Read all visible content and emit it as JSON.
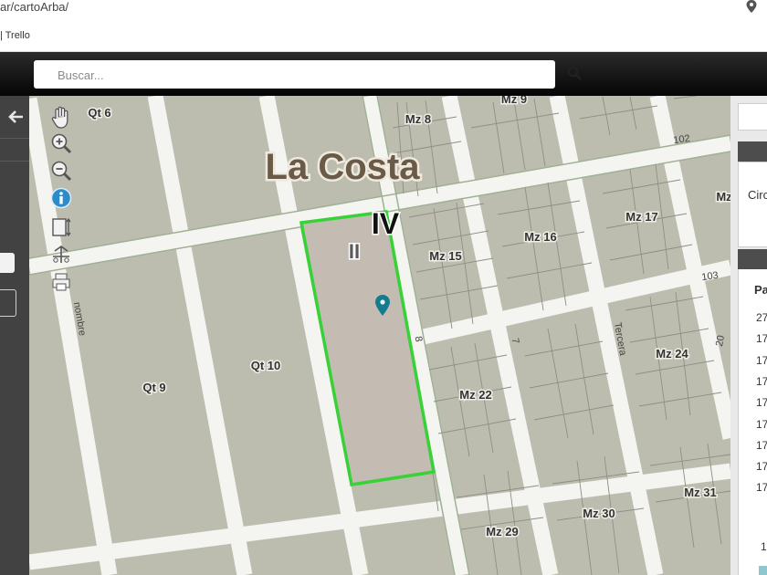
{
  "browser": {
    "url_fragment": "ar/cartoArba/",
    "bookmark": "| Trello"
  },
  "search": {
    "placeholder": "Buscar..."
  },
  "map": {
    "town_name": "La Costa",
    "parcel_labels": [
      "IV",
      "II"
    ],
    "block_labels": [
      "Qt 6",
      "Mz 8",
      "Mz 9",
      "Mz 17",
      "Mz 16",
      "Mz 15",
      "Mz",
      "Mz 24",
      "Mz 22",
      "Qt 10",
      "Qt 9",
      "Mz 31",
      "Mz 30",
      "Mz 29"
    ],
    "street_labels": [
      "102",
      "103",
      "20",
      "7",
      "8",
      "Tercera",
      "nombre"
    ]
  },
  "right_panel": {
    "circ_label": "Circ",
    "col_header": "Pa",
    "rows": [
      "27",
      "17",
      "17",
      "17",
      "17",
      "17",
      "17",
      "17",
      "17"
    ],
    "footer": "1"
  },
  "colors": {
    "parcel_outline": "#38d138",
    "marker": "#157c8f",
    "block_fill": "#bdbdaf",
    "street": "#f4f4f0"
  },
  "icons": [
    "location-pin-icon",
    "search-icon",
    "back-arrow-icon",
    "hand-pan-icon",
    "zoom-in-icon",
    "zoom-out-icon",
    "info-icon",
    "measure-icon",
    "split-icon",
    "print-icon"
  ]
}
